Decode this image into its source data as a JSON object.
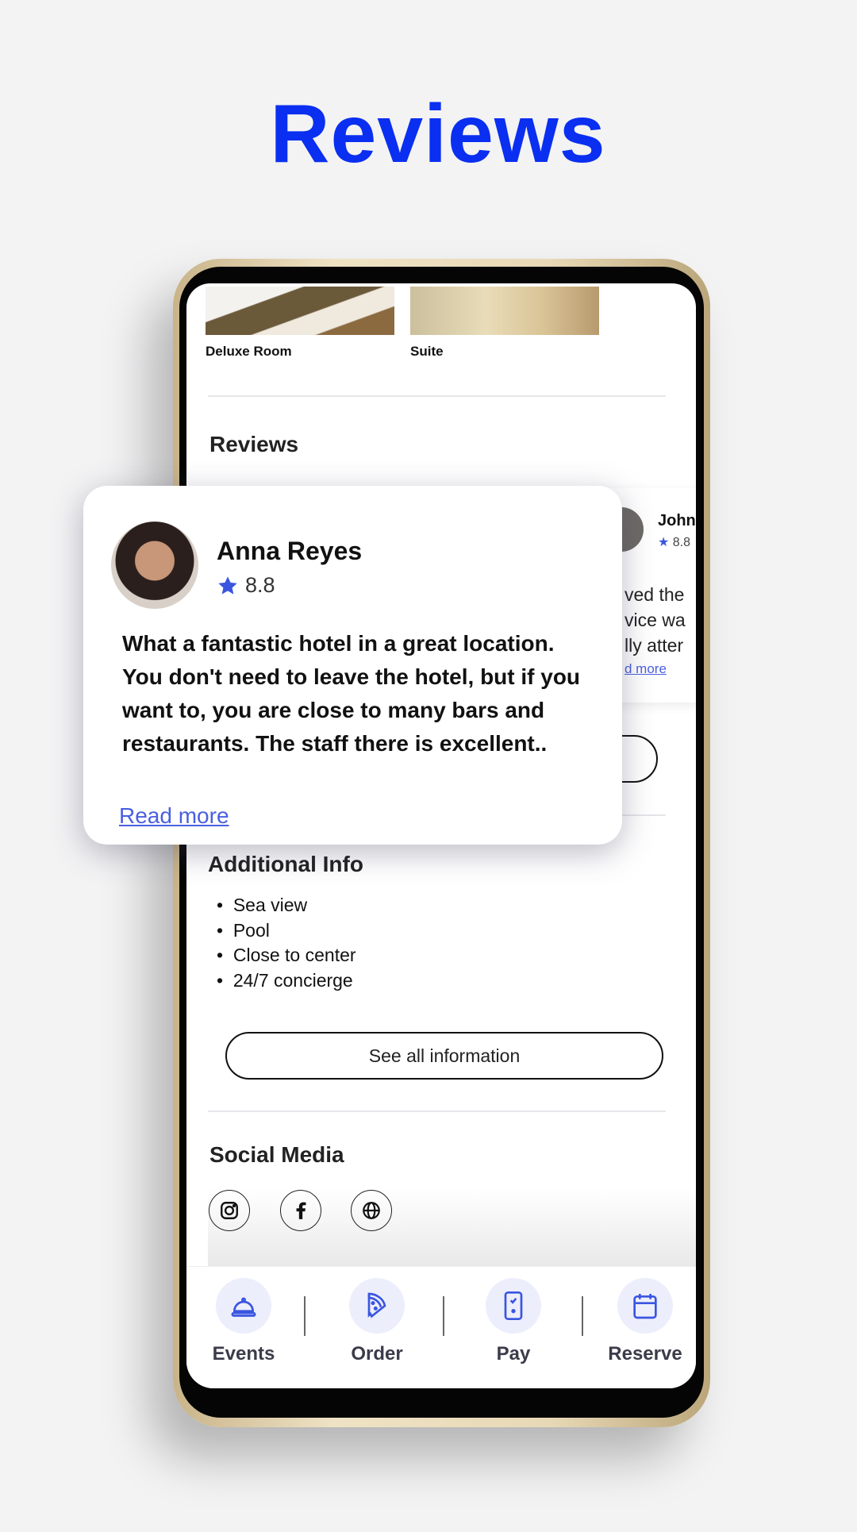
{
  "headline": "Reviews",
  "rooms": [
    {
      "label": "Deluxe Room"
    },
    {
      "label": "Suite"
    }
  ],
  "reviews_section": {
    "title": "Reviews"
  },
  "featured_review": {
    "name": "Anna Reyes",
    "rating": "8.8",
    "text": "What a fantastic hotel in a great location. You don't need to leave the hotel, but if you want to, you are close to many bars and restaurants. The staff there is excellent..",
    "read_more": "Read more"
  },
  "background_review": {
    "name": "John",
    "rating": "8.8",
    "lines": [
      "ved the",
      "vice wa",
      "lly atter"
    ],
    "read_more": "d more"
  },
  "additional_info": {
    "title": "Additional Info",
    "items": [
      "Sea view",
      "Pool",
      "Close to center",
      "24/7 concierge"
    ],
    "button": "See all information"
  },
  "social": {
    "title": "Social Media",
    "icons": [
      "instagram-icon",
      "facebook-icon",
      "globe-icon"
    ]
  },
  "nav": [
    {
      "label": "Events",
      "icon": "service-bell-icon"
    },
    {
      "label": "Order",
      "icon": "pizza-icon"
    },
    {
      "label": "Pay",
      "icon": "phone-check-icon"
    },
    {
      "label": "Reserve",
      "icon": "calendar-icon"
    }
  ],
  "colors": {
    "headline": "#0a2ff0",
    "accent": "#4a5fe0",
    "nav_circle": "#eceefc"
  }
}
